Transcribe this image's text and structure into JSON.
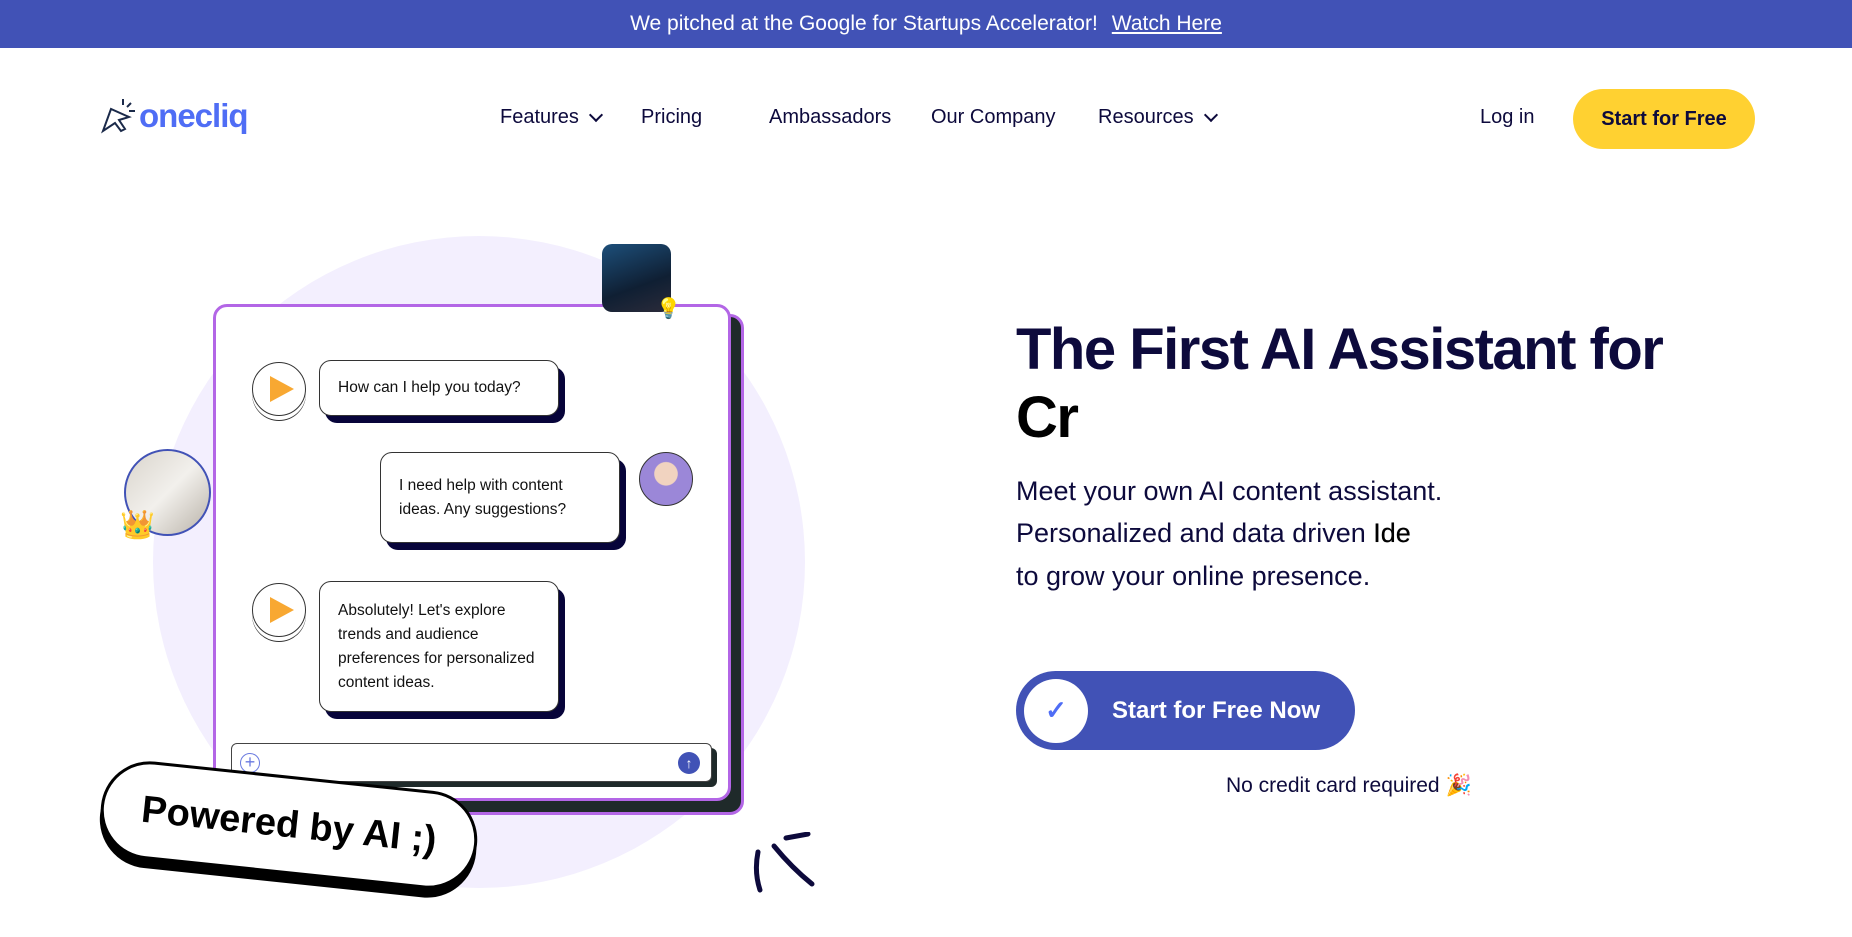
{
  "banner": {
    "text": "We pitched at the Google for Startups Accelerator!",
    "link": "Watch Here"
  },
  "nav": {
    "logo": "onecliq",
    "items": [
      "Features",
      "Pricing",
      "Ambassadors",
      "Our Company",
      "Resources"
    ],
    "login": "Log in",
    "start": "Start for Free"
  },
  "chat": {
    "messages": [
      "How can I help you today?",
      "I need help with content ideas. Any suggestions?",
      "Absolutely! Let's explore trends and audience preferences for personalized content ideas."
    ],
    "badge": "Powered by AI ;)"
  },
  "hero": {
    "title_line1": "The First AI Assistant for",
    "title_line2": "Cr",
    "sub1": "Meet your own AI content assistant.",
    "sub2": "Personalized and data driven",
    "sub2_bold": "Ide",
    "sub3": "to grow your online presence.",
    "cta": "Start for Free Now",
    "note": "No credit card required",
    "note_icon": "🎉"
  },
  "colors": {
    "brand": "#4152b6",
    "accent": "#ffd131",
    "frame": "#b366e6"
  }
}
